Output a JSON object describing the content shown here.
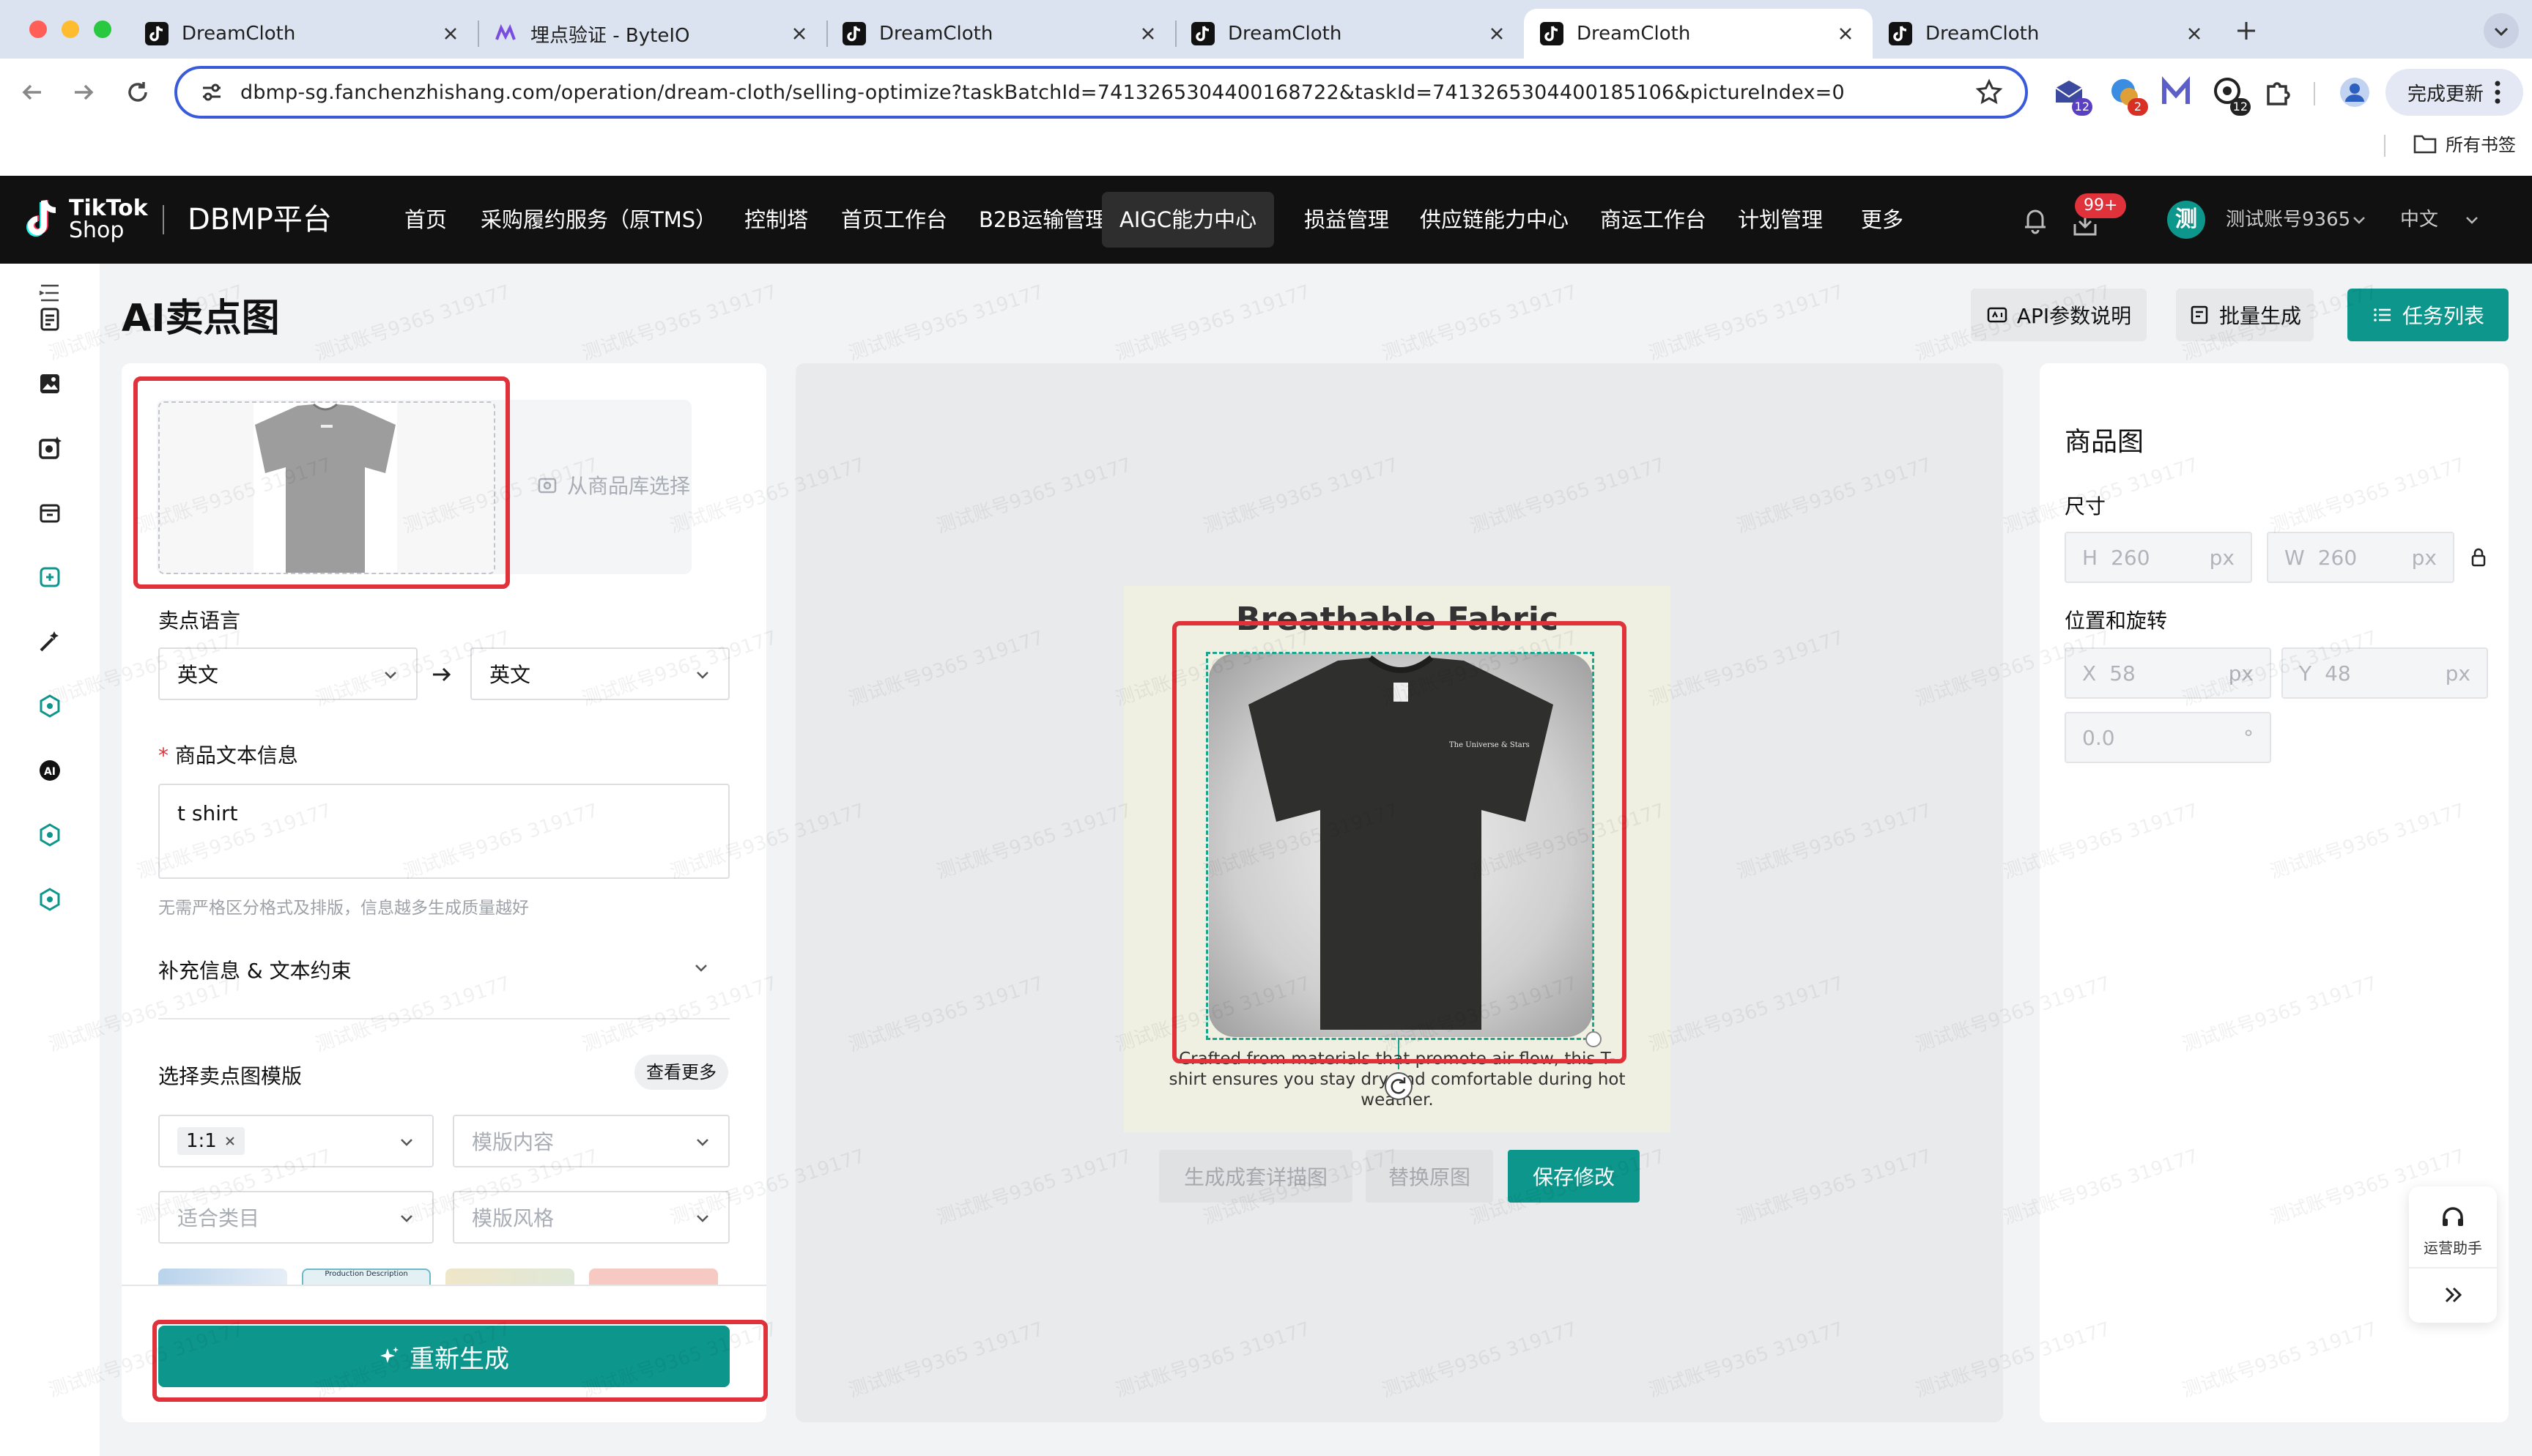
{
  "browser": {
    "tabs": [
      {
        "title": "DreamCloth",
        "icon": "tiktok-icon",
        "active": false
      },
      {
        "title": "埋点验证 - ByteIO",
        "icon": "byteio-icon",
        "active": false
      },
      {
        "title": "DreamCloth",
        "icon": "tiktok-icon",
        "active": false
      },
      {
        "title": "DreamCloth",
        "icon": "tiktok-icon",
        "active": false
      },
      {
        "title": "DreamCloth",
        "icon": "tiktok-icon",
        "active": true
      },
      {
        "title": "DreamCloth",
        "icon": "tiktok-icon",
        "active": false
      }
    ],
    "url": "dbmp-sg.fanchenzhishang.com/operation/dream-cloth/selling-optimize?taskBatchId=7413265304400168722&taskId=7413265304400185106&pictureIndex=0",
    "extension_badges": [
      "12",
      "2",
      "12"
    ],
    "update_label": "完成更新",
    "bookmarks_label": "所有书签"
  },
  "header": {
    "brand_top": "TikTok",
    "brand_bottom": "Shop",
    "platform": "DBMP平台",
    "nav": [
      "首页",
      "采购履约服务（原TMS）",
      "控制塔",
      "首页工作台",
      "B2B运输管理",
      "AIGC能力中心",
      "损益管理",
      "供应链能力中心",
      "商运工作台",
      "计划管理",
      "更多"
    ],
    "active_nav": "AIGC能力中心",
    "notification_badge": "99+",
    "avatar_char": "测",
    "account": "测试账号9365",
    "language": "中文"
  },
  "page": {
    "title": "AI卖点图",
    "api_doc": "API参数说明",
    "batch_generate": "批量生成",
    "task_list": "任务列表"
  },
  "left": {
    "pick_from_library": "从商品库选择",
    "lang_label": "卖点语言",
    "lang_from": "英文",
    "lang_to": "英文",
    "required_mark": "*",
    "text_label": "商品文本信息",
    "text_value": "t shirt",
    "text_hint": "无需严格区分格式及排版，信息越多生成质量越好",
    "supplement_label": "补充信息 & 文本约束",
    "template_label": "选择卖点图模版",
    "view_more": "查看更多",
    "ratio_tag": "1:1",
    "template_content_ph": "模版内容",
    "category_ph": "适合类目",
    "style_ph": "模版风格",
    "thumb2_text": "Production Description",
    "regenerate": "重新生成"
  },
  "canvas": {
    "headline": "Breathable Fabric",
    "body": "Crafted from materials that promote air flow, this T-shirt ensures you stay dry and comfortable during hot weather.",
    "shirt_print": "The Universe & Stars",
    "btn_generate_set": "生成成套详描图",
    "btn_replace": "替换原图",
    "btn_save": "保存修改"
  },
  "right": {
    "title": "商品图",
    "size_label": "尺寸",
    "h_prefix": "H",
    "h_value": "260",
    "w_prefix": "W",
    "w_value": "260",
    "unit": "px",
    "pos_label": "位置和旋转",
    "x_prefix": "X",
    "x_value": "58",
    "y_prefix": "Y",
    "y_value": "48",
    "rotation": "0.0",
    "deg": "°"
  },
  "helper": {
    "label": "运营助手"
  },
  "watermark": "测试账号9365 319177",
  "colors": {
    "accent": "#0d978c",
    "highlight": "#e0323a",
    "omnibox": "#3a5bd9"
  }
}
